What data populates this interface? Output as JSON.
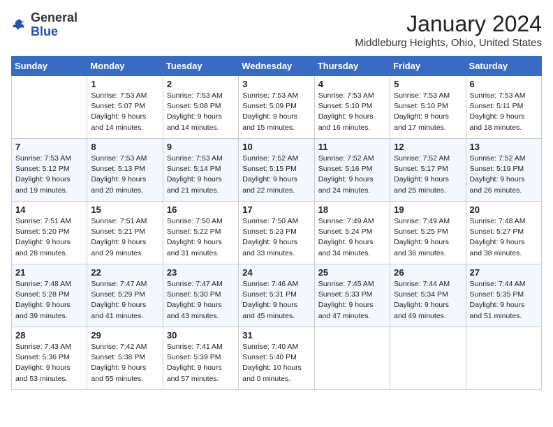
{
  "logo": {
    "line1": "General",
    "line2": "Blue"
  },
  "title": "January 2024",
  "subtitle": "Middleburg Heights, Ohio, United States",
  "days_of_week": [
    "Sunday",
    "Monday",
    "Tuesday",
    "Wednesday",
    "Thursday",
    "Friday",
    "Saturday"
  ],
  "weeks": [
    [
      {
        "day": "",
        "info": ""
      },
      {
        "day": "1",
        "info": "Sunrise: 7:53 AM\nSunset: 5:07 PM\nDaylight: 9 hours\nand 14 minutes."
      },
      {
        "day": "2",
        "info": "Sunrise: 7:53 AM\nSunset: 5:08 PM\nDaylight: 9 hours\nand 14 minutes."
      },
      {
        "day": "3",
        "info": "Sunrise: 7:53 AM\nSunset: 5:09 PM\nDaylight: 9 hours\nand 15 minutes."
      },
      {
        "day": "4",
        "info": "Sunrise: 7:53 AM\nSunset: 5:10 PM\nDaylight: 9 hours\nand 16 minutes."
      },
      {
        "day": "5",
        "info": "Sunrise: 7:53 AM\nSunset: 5:10 PM\nDaylight: 9 hours\nand 17 minutes."
      },
      {
        "day": "6",
        "info": "Sunrise: 7:53 AM\nSunset: 5:11 PM\nDaylight: 9 hours\nand 18 minutes."
      }
    ],
    [
      {
        "day": "7",
        "info": "Sunrise: 7:53 AM\nSunset: 5:12 PM\nDaylight: 9 hours\nand 19 minutes."
      },
      {
        "day": "8",
        "info": "Sunrise: 7:53 AM\nSunset: 5:13 PM\nDaylight: 9 hours\nand 20 minutes."
      },
      {
        "day": "9",
        "info": "Sunrise: 7:53 AM\nSunset: 5:14 PM\nDaylight: 9 hours\nand 21 minutes."
      },
      {
        "day": "10",
        "info": "Sunrise: 7:52 AM\nSunset: 5:15 PM\nDaylight: 9 hours\nand 22 minutes."
      },
      {
        "day": "11",
        "info": "Sunrise: 7:52 AM\nSunset: 5:16 PM\nDaylight: 9 hours\nand 24 minutes."
      },
      {
        "day": "12",
        "info": "Sunrise: 7:52 AM\nSunset: 5:17 PM\nDaylight: 9 hours\nand 25 minutes."
      },
      {
        "day": "13",
        "info": "Sunrise: 7:52 AM\nSunset: 5:19 PM\nDaylight: 9 hours\nand 26 minutes."
      }
    ],
    [
      {
        "day": "14",
        "info": "Sunrise: 7:51 AM\nSunset: 5:20 PM\nDaylight: 9 hours\nand 28 minutes."
      },
      {
        "day": "15",
        "info": "Sunrise: 7:51 AM\nSunset: 5:21 PM\nDaylight: 9 hours\nand 29 minutes."
      },
      {
        "day": "16",
        "info": "Sunrise: 7:50 AM\nSunset: 5:22 PM\nDaylight: 9 hours\nand 31 minutes."
      },
      {
        "day": "17",
        "info": "Sunrise: 7:50 AM\nSunset: 5:23 PM\nDaylight: 9 hours\nand 33 minutes."
      },
      {
        "day": "18",
        "info": "Sunrise: 7:49 AM\nSunset: 5:24 PM\nDaylight: 9 hours\nand 34 minutes."
      },
      {
        "day": "19",
        "info": "Sunrise: 7:49 AM\nSunset: 5:25 PM\nDaylight: 9 hours\nand 36 minutes."
      },
      {
        "day": "20",
        "info": "Sunrise: 7:48 AM\nSunset: 5:27 PM\nDaylight: 9 hours\nand 38 minutes."
      }
    ],
    [
      {
        "day": "21",
        "info": "Sunrise: 7:48 AM\nSunset: 5:28 PM\nDaylight: 9 hours\nand 39 minutes."
      },
      {
        "day": "22",
        "info": "Sunrise: 7:47 AM\nSunset: 5:29 PM\nDaylight: 9 hours\nand 41 minutes."
      },
      {
        "day": "23",
        "info": "Sunrise: 7:47 AM\nSunset: 5:30 PM\nDaylight: 9 hours\nand 43 minutes."
      },
      {
        "day": "24",
        "info": "Sunrise: 7:46 AM\nSunset: 5:31 PM\nDaylight: 9 hours\nand 45 minutes."
      },
      {
        "day": "25",
        "info": "Sunrise: 7:45 AM\nSunset: 5:33 PM\nDaylight: 9 hours\nand 47 minutes."
      },
      {
        "day": "26",
        "info": "Sunrise: 7:44 AM\nSunset: 5:34 PM\nDaylight: 9 hours\nand 49 minutes."
      },
      {
        "day": "27",
        "info": "Sunrise: 7:44 AM\nSunset: 5:35 PM\nDaylight: 9 hours\nand 51 minutes."
      }
    ],
    [
      {
        "day": "28",
        "info": "Sunrise: 7:43 AM\nSunset: 5:36 PM\nDaylight: 9 hours\nand 53 minutes."
      },
      {
        "day": "29",
        "info": "Sunrise: 7:42 AM\nSunset: 5:38 PM\nDaylight: 9 hours\nand 55 minutes."
      },
      {
        "day": "30",
        "info": "Sunrise: 7:41 AM\nSunset: 5:39 PM\nDaylight: 9 hours\nand 57 minutes."
      },
      {
        "day": "31",
        "info": "Sunrise: 7:40 AM\nSunset: 5:40 PM\nDaylight: 10 hours\nand 0 minutes."
      },
      {
        "day": "",
        "info": ""
      },
      {
        "day": "",
        "info": ""
      },
      {
        "day": "",
        "info": ""
      }
    ]
  ]
}
